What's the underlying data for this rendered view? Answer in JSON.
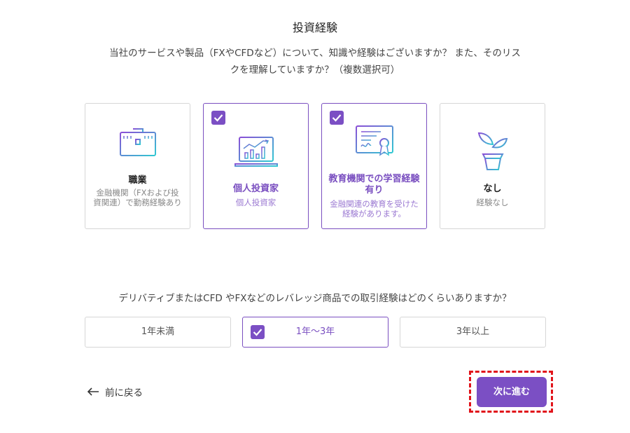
{
  "page": {
    "title": "投資経験",
    "question_line1": "当社のサービスや製品（FXやCFDなど）について、知識や経験はございますか？ また、そのリス",
    "question_line2": "クを理解していますか？（複数選択可）"
  },
  "experience_cards": [
    {
      "title": "職業",
      "description": "金融機関（FXおよび投資関連）で勤務経験あり",
      "selected": false,
      "icon": "briefcase-icon"
    },
    {
      "title": "個人投資家",
      "description": "個人投資家",
      "selected": true,
      "icon": "laptop-chart-icon"
    },
    {
      "title": "教育機関での学習経験有り",
      "description": "金融関連の教育を受けた経験があります。",
      "selected": true,
      "icon": "certificate-icon"
    },
    {
      "title": "なし",
      "description": "経験なし",
      "selected": false,
      "icon": "plant-pot-icon"
    }
  ],
  "leverage": {
    "question": "デリバティブまたはCFD やFXなどのレバレッジ商品での取引経験はどのくらいありますか？",
    "options": [
      "1年未満",
      "1年〜3年",
      "3年以上"
    ],
    "selected_option": "1年〜3年"
  },
  "navigation": {
    "back_label": "前に戻る",
    "next_label": "次に進む"
  },
  "colors": {
    "accent": "#7b4fc4",
    "highlight": "#e1141b",
    "icon_gradient_start": "#8a4fd6",
    "icon_gradient_end": "#2fc9d2"
  }
}
